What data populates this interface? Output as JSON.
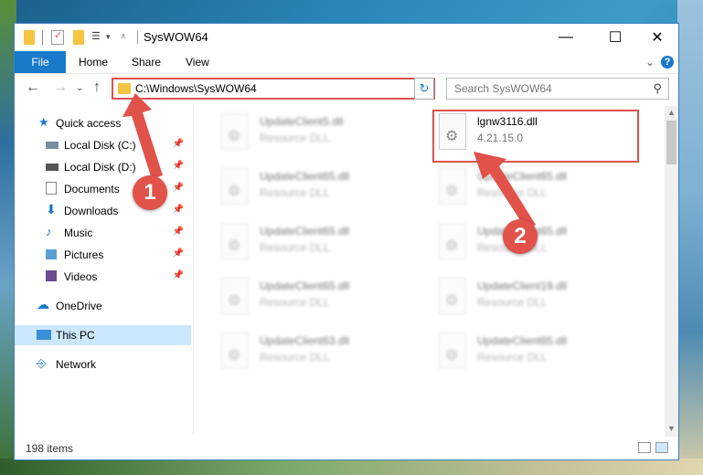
{
  "window": {
    "title": "SysWOW64"
  },
  "ribbon": {
    "tabs": [
      "File",
      "Home",
      "Share",
      "View"
    ]
  },
  "address": {
    "path": "C:\\Windows\\SysWOW64"
  },
  "search": {
    "placeholder": "Search SysWOW64"
  },
  "nav": {
    "items": [
      {
        "label": "Quick access",
        "icon": "star-icon"
      },
      {
        "label": "Local Disk (C:)",
        "icon": "drive-icon"
      },
      {
        "label": "Local Disk (D:)",
        "icon": "drive-icon"
      },
      {
        "label": "Documents",
        "icon": "documents-icon"
      },
      {
        "label": "Downloads",
        "icon": "download-icon"
      },
      {
        "label": "Music",
        "icon": "music-icon"
      },
      {
        "label": "Pictures",
        "icon": "pictures-icon"
      },
      {
        "label": "Videos",
        "icon": "videos-icon"
      },
      {
        "label": "OneDrive",
        "icon": "cloud-icon"
      },
      {
        "label": "This PC",
        "icon": "computer-icon"
      },
      {
        "label": "Network",
        "icon": "network-icon"
      }
    ]
  },
  "files": {
    "highlight": {
      "name": "lgnw3116.dll",
      "desc": "4.21.15.0"
    },
    "items": [
      {
        "name": "UpdateClient5.dll",
        "desc": "Resource DLL"
      },
      {
        "name": "UpdateClient65.dll",
        "desc": "Resource DLL"
      },
      {
        "name": "UpdateClient65.dll",
        "desc": "Resource DLL"
      },
      {
        "name": "UpdateClient65.dll",
        "desc": "Resource DLL"
      },
      {
        "name": "UpdateClient65.dll",
        "desc": "Resource DLL"
      },
      {
        "name": "UpdateClient65.dll",
        "desc": "Resource DLL"
      },
      {
        "name": "UpdateClient65.dll",
        "desc": "Resource DLL"
      },
      {
        "name": "UpdateClient19.dll",
        "desc": "Resource DLL"
      },
      {
        "name": "UpdateClient63.dll",
        "desc": "Resource DLL"
      },
      {
        "name": "UpdateClient65.dll",
        "desc": "Resource DLL"
      }
    ]
  },
  "status": {
    "count": "198 items"
  },
  "annotations": {
    "step1": "1",
    "step2": "2",
    "color": "#e0524a"
  }
}
